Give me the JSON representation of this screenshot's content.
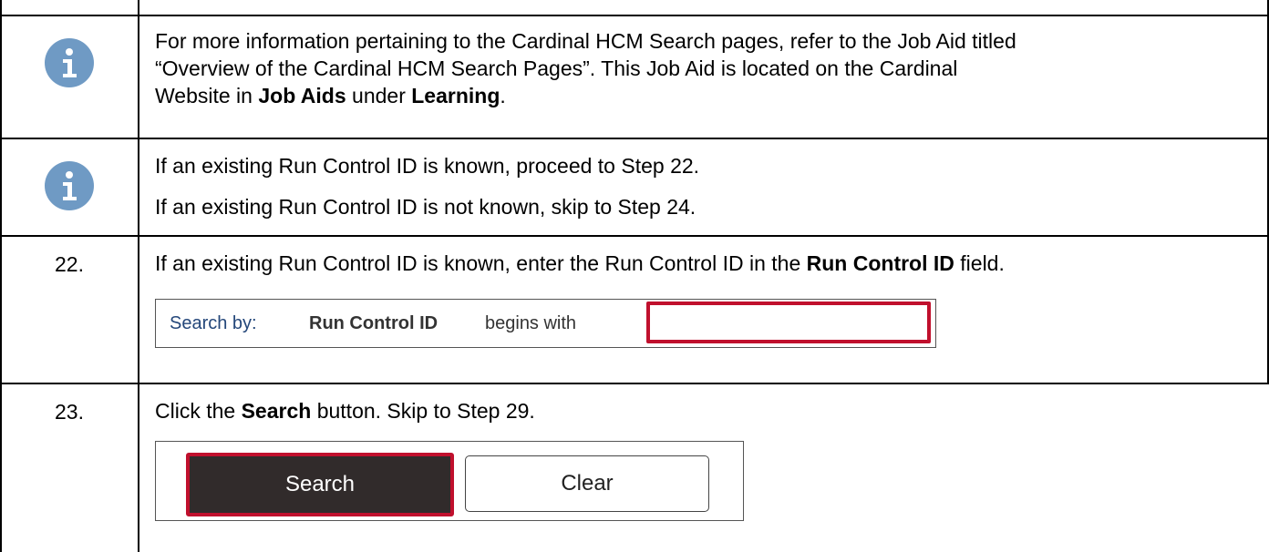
{
  "rows": {
    "note1": {
      "line1": "For more information pertaining to the Cardinal HCM Search pages, refer to the Job Aid titled",
      "line2": "“Overview of the Cardinal HCM Search Pages”.  This Job Aid is located on the Cardinal",
      "line3_pre": "Website in ",
      "line3_bold1": "Job Aids",
      "line3_mid": " under ",
      "line3_bold2": "Learning",
      "line3_post": "."
    },
    "note2": {
      "line1": "If an existing Run Control ID is known, proceed to Step 22.",
      "line2": "If an existing Run Control ID is not known, skip to Step 24."
    },
    "step22": {
      "number": "22.",
      "text_pre": "If an existing Run Control ID is known, enter the Run Control ID in the ",
      "text_bold": "Run Control ID",
      "text_post": " field.",
      "search_by_label": "Search by:",
      "search_field": "Run Control ID",
      "search_operator": "begins with",
      "input_value": ""
    },
    "step23": {
      "number": "23.",
      "text_pre": "Click the ",
      "text_bold": "Search",
      "text_post": " button.  Skip to Step 29.",
      "search_button": "Search",
      "clear_button": "Clear"
    }
  },
  "colors": {
    "icon_blue": "#6f9ac4",
    "highlight_red": "#c0102d",
    "search_button_bg": "#312b2b",
    "label_blue": "#24477a"
  },
  "icons": {
    "info": "info-icon"
  }
}
